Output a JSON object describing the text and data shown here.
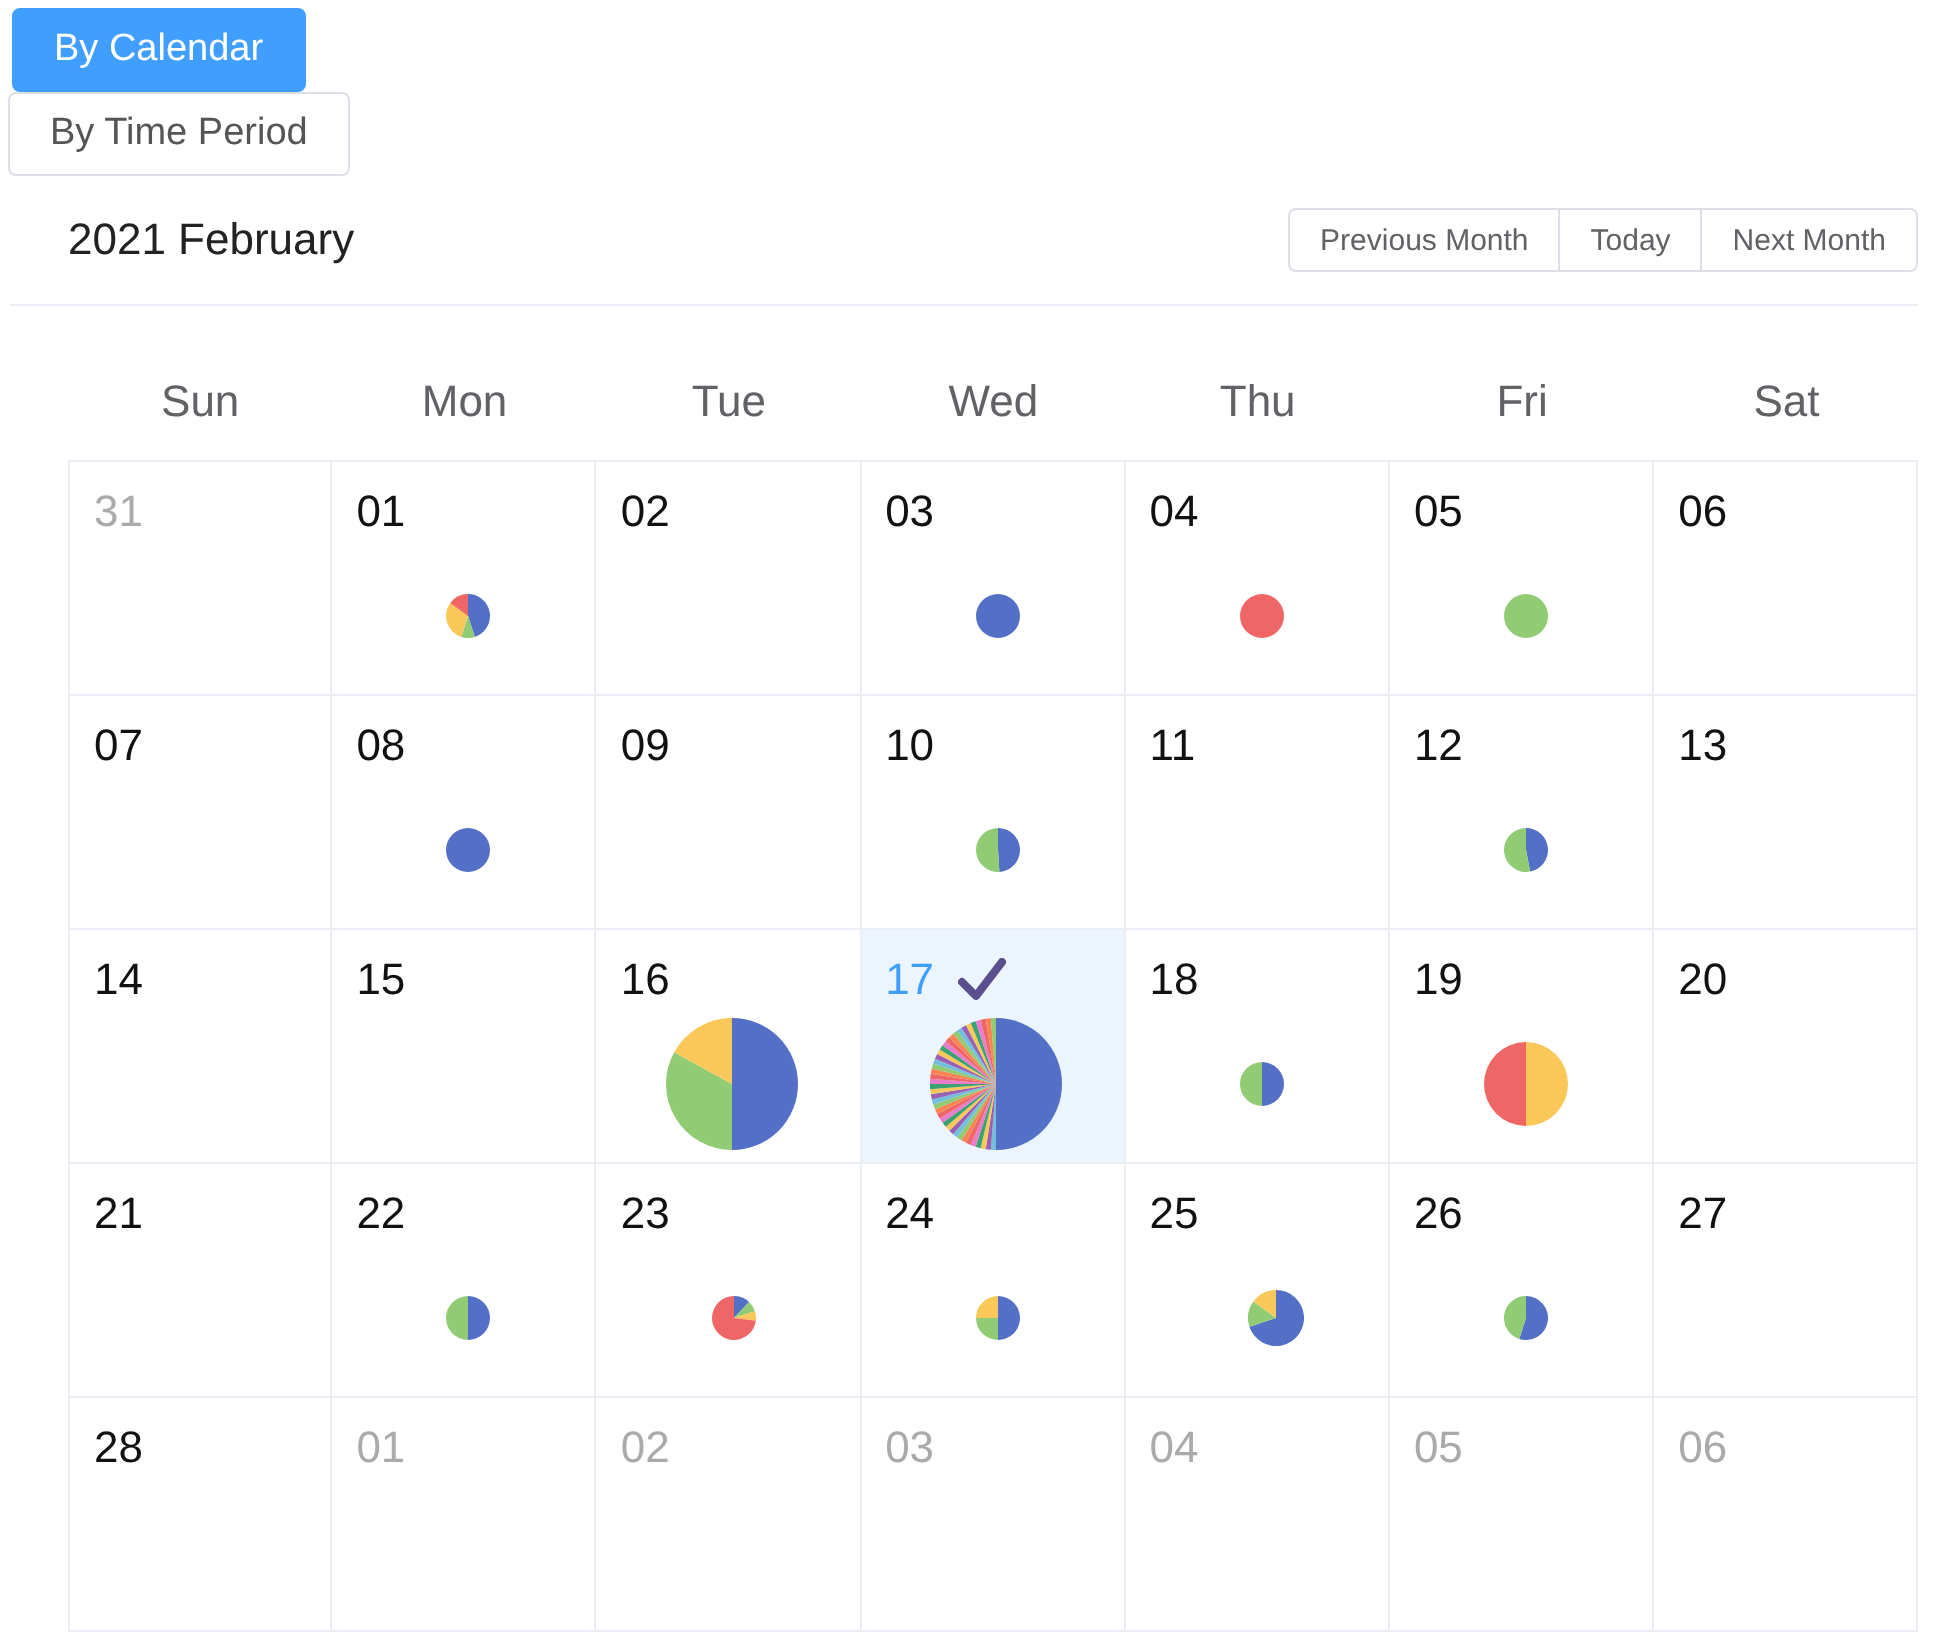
{
  "view_tabs": [
    {
      "label": "By Calendar",
      "selected": true
    },
    {
      "label": "By Time Period",
      "selected": false
    }
  ],
  "month_title": "2021 February",
  "nav_buttons": [
    "Previous Month",
    "Today",
    "Next Month"
  ],
  "weekdays": [
    "Sun",
    "Mon",
    "Tue",
    "Wed",
    "Thu",
    "Fri",
    "Sat"
  ],
  "days": [
    {
      "label": "31",
      "muted": true,
      "selected": false
    },
    {
      "label": "01",
      "muted": false,
      "selected": false
    },
    {
      "label": "02",
      "muted": false,
      "selected": false
    },
    {
      "label": "03",
      "muted": false,
      "selected": false
    },
    {
      "label": "04",
      "muted": false,
      "selected": false
    },
    {
      "label": "05",
      "muted": false,
      "selected": false
    },
    {
      "label": "06",
      "muted": false,
      "selected": false
    },
    {
      "label": "07",
      "muted": false,
      "selected": false
    },
    {
      "label": "08",
      "muted": false,
      "selected": false
    },
    {
      "label": "09",
      "muted": false,
      "selected": false
    },
    {
      "label": "10",
      "muted": false,
      "selected": false
    },
    {
      "label": "11",
      "muted": false,
      "selected": false
    },
    {
      "label": "12",
      "muted": false,
      "selected": false
    },
    {
      "label": "13",
      "muted": false,
      "selected": false
    },
    {
      "label": "14",
      "muted": false,
      "selected": false
    },
    {
      "label": "15",
      "muted": false,
      "selected": false
    },
    {
      "label": "16",
      "muted": false,
      "selected": false
    },
    {
      "label": "17",
      "muted": false,
      "selected": true
    },
    {
      "label": "18",
      "muted": false,
      "selected": false
    },
    {
      "label": "19",
      "muted": false,
      "selected": false
    },
    {
      "label": "20",
      "muted": false,
      "selected": false
    },
    {
      "label": "21",
      "muted": false,
      "selected": false
    },
    {
      "label": "22",
      "muted": false,
      "selected": false
    },
    {
      "label": "23",
      "muted": false,
      "selected": false
    },
    {
      "label": "24",
      "muted": false,
      "selected": false
    },
    {
      "label": "25",
      "muted": false,
      "selected": false
    },
    {
      "label": "26",
      "muted": false,
      "selected": false
    },
    {
      "label": "27",
      "muted": false,
      "selected": false
    },
    {
      "label": "28",
      "muted": false,
      "selected": false
    },
    {
      "label": "01",
      "muted": true,
      "selected": false
    },
    {
      "label": "02",
      "muted": true,
      "selected": false
    },
    {
      "label": "03",
      "muted": true,
      "selected": false
    },
    {
      "label": "04",
      "muted": true,
      "selected": false
    },
    {
      "label": "05",
      "muted": true,
      "selected": false
    },
    {
      "label": "06",
      "muted": true,
      "selected": false
    }
  ]
}
